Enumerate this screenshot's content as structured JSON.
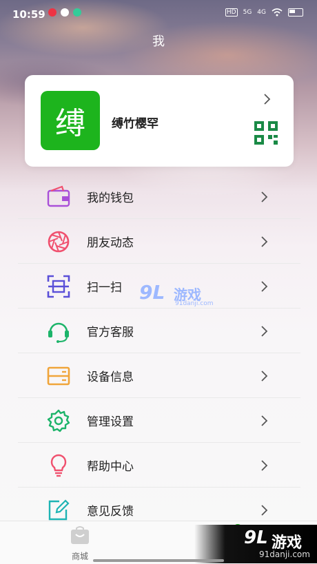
{
  "status_bar": {
    "time": "10:59",
    "net1": "5G",
    "net2": "4G",
    "hd": "HD"
  },
  "header": {
    "title": "我"
  },
  "profile": {
    "avatar_char": "缚",
    "name": "缚竹樱罕"
  },
  "menu": [
    {
      "label": "我的钱包",
      "icon": "wallet-icon",
      "color": "#a94fd8"
    },
    {
      "label": "朋友动态",
      "icon": "aperture-icon",
      "color": "#f0506e"
    },
    {
      "label": "扫一扫",
      "icon": "scan-icon",
      "color": "#5a4fd8"
    },
    {
      "label": "官方客服",
      "icon": "headset-icon",
      "color": "#1db46a"
    },
    {
      "label": "设备信息",
      "icon": "device-icon",
      "color": "#f0a43a"
    },
    {
      "label": "管理设置",
      "icon": "gear-icon",
      "color": "#1db46a"
    },
    {
      "label": "帮助中心",
      "icon": "lightbulb-icon",
      "color": "#f0506e"
    },
    {
      "label": "意见反馈",
      "icon": "feedback-icon",
      "color": "#1db4b4"
    }
  ],
  "tabbar": {
    "shop_label": "商城"
  },
  "watermark": {
    "logo": "9L",
    "brand": "游戏",
    "site": "91danji.com"
  }
}
